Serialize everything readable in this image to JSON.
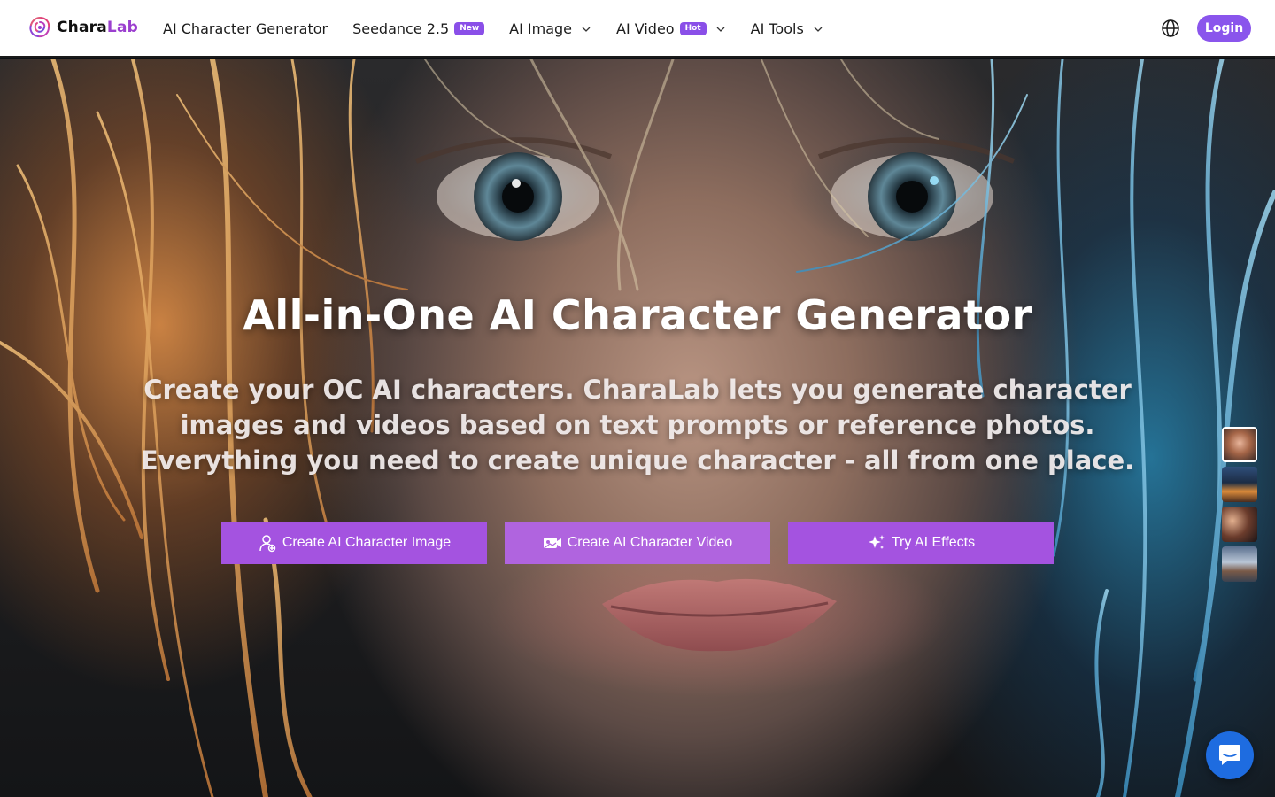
{
  "brand": {
    "name_part1": "Chara",
    "name_part2": "Lab",
    "accent": "#9b3fcf",
    "logo_icon": "swirl-logo-icon"
  },
  "nav": {
    "items": [
      {
        "label": "AI Character Generator"
      },
      {
        "label": "Seedance 2.5",
        "badge": "New"
      },
      {
        "label": "AI Image",
        "icon": "chevron-down-icon"
      },
      {
        "label": "AI Video",
        "badge": "Hot",
        "icon": "chevron-down-icon"
      },
      {
        "label": "AI Tools",
        "icon": "chevron-down-icon"
      }
    ],
    "language_icon": "globe-icon",
    "login_label": "Login",
    "login_color": "#8a55ec"
  },
  "hero": {
    "title": "All-in-One AI Character Generator",
    "subtitle": "Create your OC AI characters. CharaLab lets you generate character images and videos based on text prompts or reference photos. Everything you need to create unique character - all from one place.",
    "buttons": [
      {
        "label": "Create AI Character Image",
        "icon": "user-sparkle-icon"
      },
      {
        "label": "Create AI Character Video",
        "icon": "video-camera-icon"
      },
      {
        "label": "Try AI Effects",
        "icon": "sparkles-icon"
      }
    ],
    "button_color": "#a453e0",
    "thumbnails": [
      {
        "name": "character-portrait-thumb",
        "active": true
      },
      {
        "name": "night-city-thumb",
        "active": false
      },
      {
        "name": "characters-group-thumb",
        "active": false
      },
      {
        "name": "landscape-thumb",
        "active": false
      }
    ]
  },
  "chat": {
    "icon": "chat-bubble-icon",
    "color": "#1e6ce0"
  }
}
